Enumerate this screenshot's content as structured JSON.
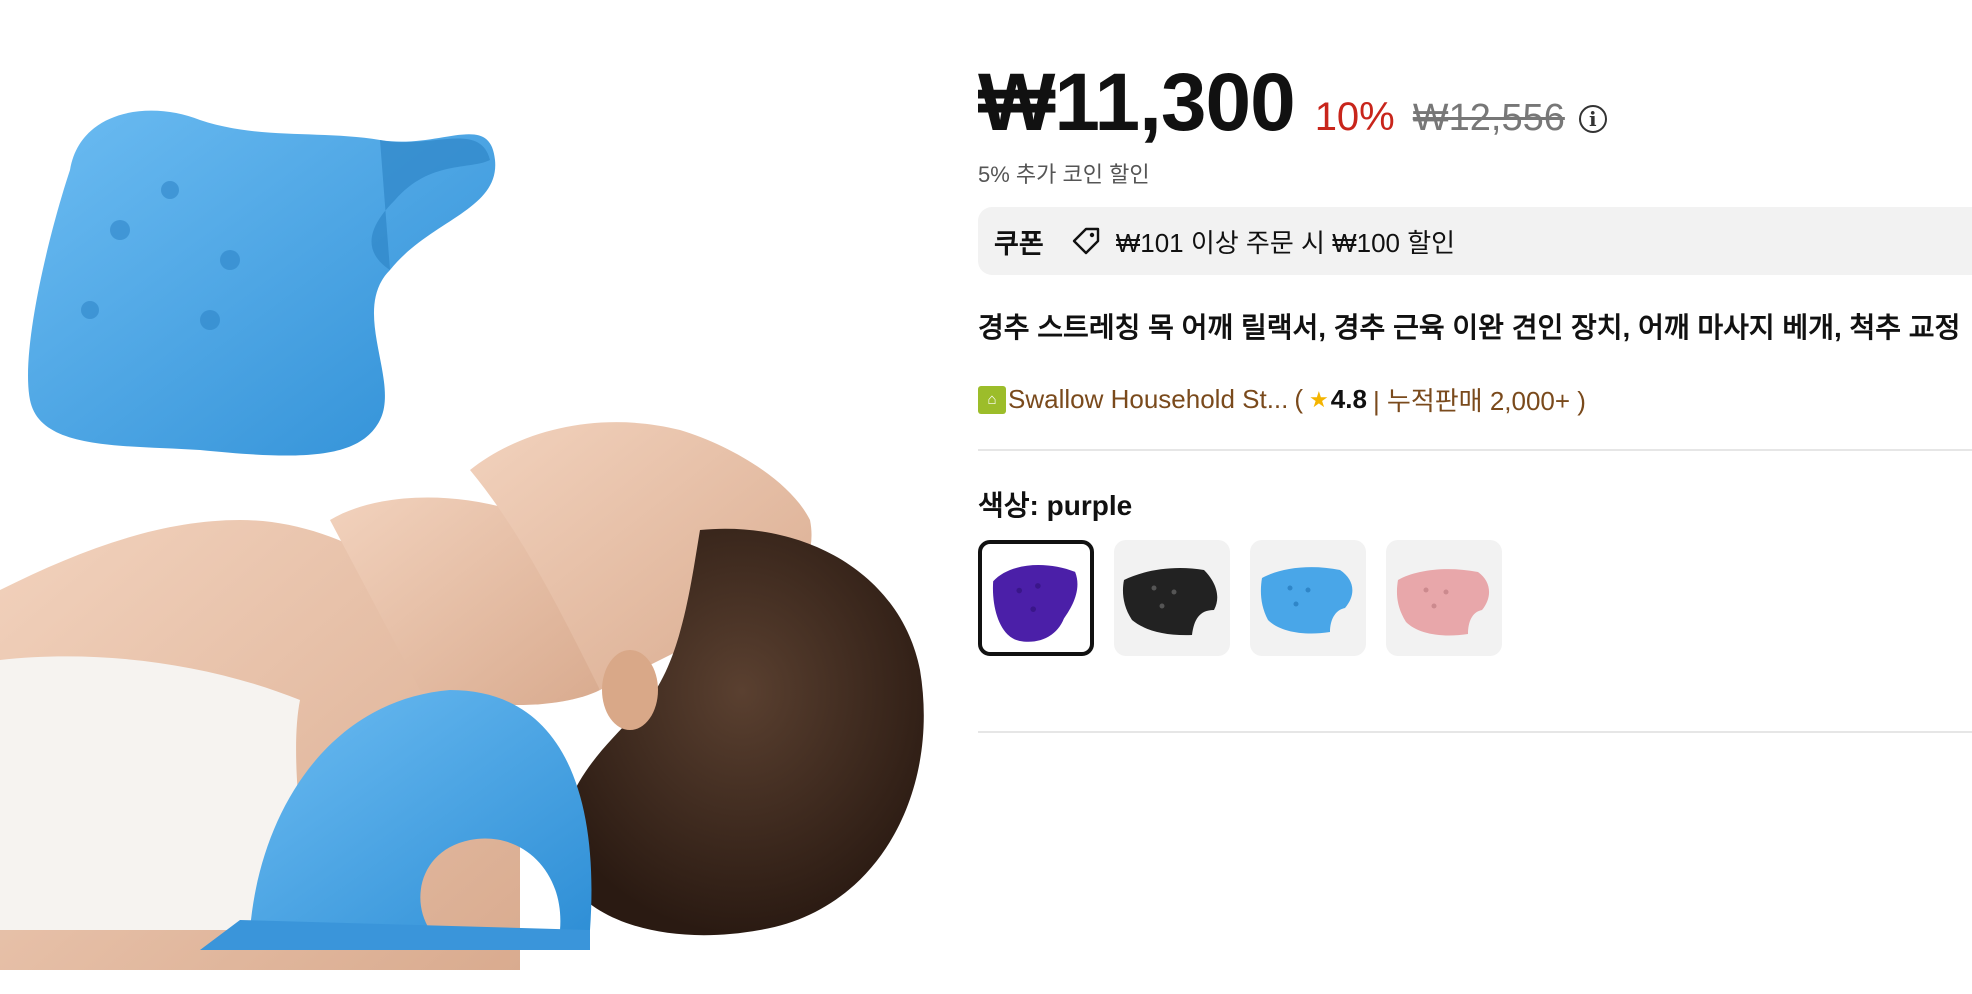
{
  "price": {
    "current": "₩11,300",
    "discount": "10%",
    "original": "₩12,556",
    "coin_note": "5% 추가 코인 할인"
  },
  "coupon": {
    "label": "쿠폰",
    "text": "₩101 이상 주문 시 ₩100 할인"
  },
  "product": {
    "title": "경추 스트레칭 목 어깨 릴랙서, 경추 근육 이완 견인 장치, 어깨 마사지 베개, 척추 교정"
  },
  "store": {
    "name": "Swallow Household St...",
    "paren_open": "(",
    "rating": "4.8",
    "sales": "| 누적판매 2,000+ )"
  },
  "color": {
    "label": "색상: purple",
    "options": [
      {
        "name": "purple",
        "color": "#4b1fa8",
        "selected": true
      },
      {
        "name": "black",
        "color": "#222222",
        "selected": false
      },
      {
        "name": "blue",
        "color": "#49a6e8",
        "selected": false
      },
      {
        "name": "pink",
        "color": "#e8a7aa",
        "selected": false
      }
    ]
  },
  "colors": {
    "discount_red": "#c8251b",
    "store_brown": "#7a4a1c",
    "star_yellow": "#f4b400",
    "pillow_blue": "#4aa3e6"
  },
  "icons": [
    "info-icon",
    "tag-icon",
    "store-icon",
    "star-icon"
  ]
}
